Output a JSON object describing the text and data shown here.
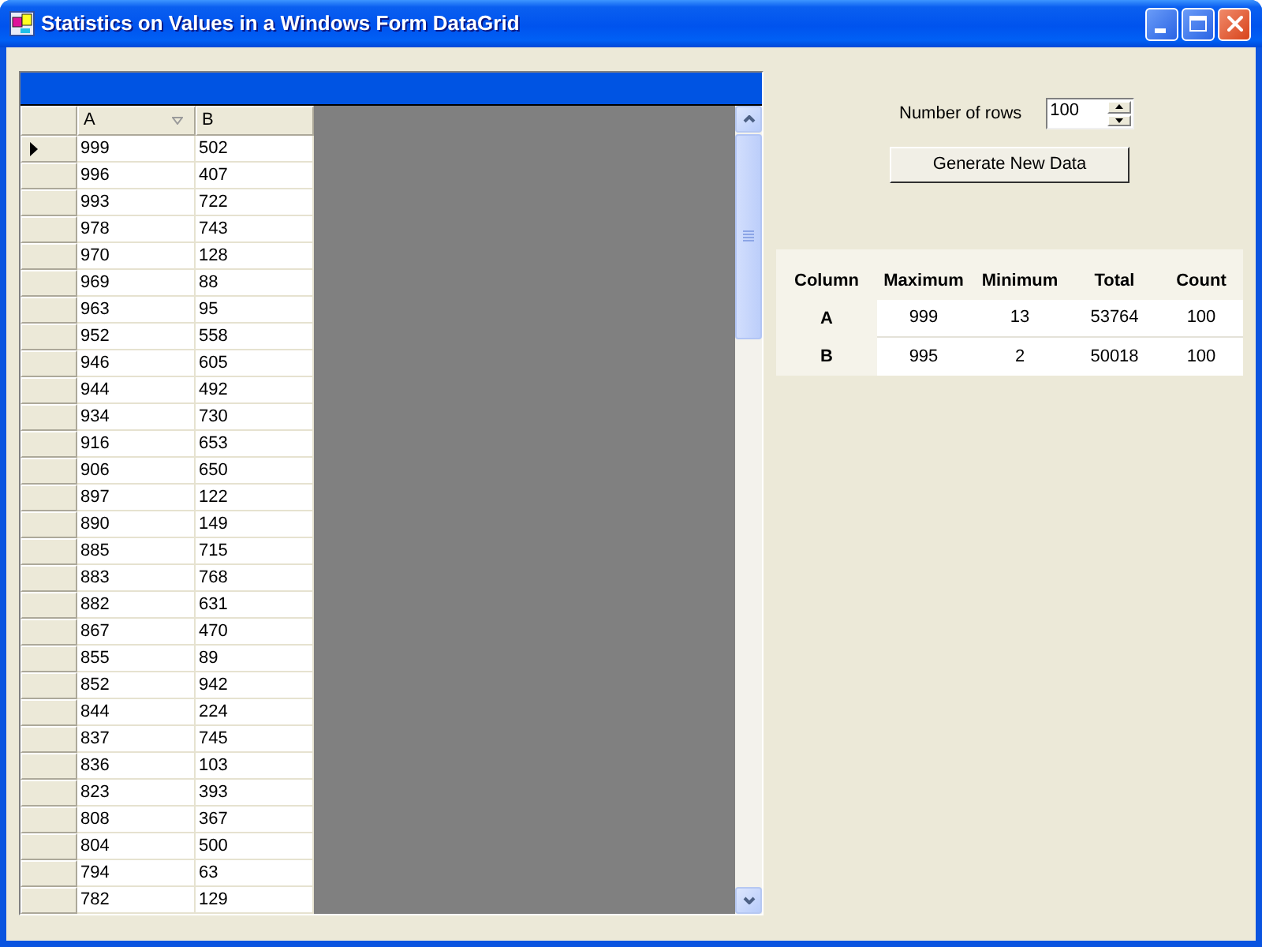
{
  "window": {
    "title": "Statistics on Values in a Windows Form DataGrid"
  },
  "data_grid": {
    "columns": [
      {
        "label": "A",
        "sorted": true
      },
      {
        "label": "B",
        "sorted": false
      }
    ],
    "rows": [
      {
        "selected": true,
        "cells": [
          "999",
          "502"
        ]
      },
      {
        "selected": false,
        "cells": [
          "996",
          "407"
        ]
      },
      {
        "selected": false,
        "cells": [
          "993",
          "722"
        ]
      },
      {
        "selected": false,
        "cells": [
          "978",
          "743"
        ]
      },
      {
        "selected": false,
        "cells": [
          "970",
          "128"
        ]
      },
      {
        "selected": false,
        "cells": [
          "969",
          "88"
        ]
      },
      {
        "selected": false,
        "cells": [
          "963",
          "95"
        ]
      },
      {
        "selected": false,
        "cells": [
          "952",
          "558"
        ]
      },
      {
        "selected": false,
        "cells": [
          "946",
          "605"
        ]
      },
      {
        "selected": false,
        "cells": [
          "944",
          "492"
        ]
      },
      {
        "selected": false,
        "cells": [
          "934",
          "730"
        ]
      },
      {
        "selected": false,
        "cells": [
          "916",
          "653"
        ]
      },
      {
        "selected": false,
        "cells": [
          "906",
          "650"
        ]
      },
      {
        "selected": false,
        "cells": [
          "897",
          "122"
        ]
      },
      {
        "selected": false,
        "cells": [
          "890",
          "149"
        ]
      },
      {
        "selected": false,
        "cells": [
          "885",
          "715"
        ]
      },
      {
        "selected": false,
        "cells": [
          "883",
          "768"
        ]
      },
      {
        "selected": false,
        "cells": [
          "882",
          "631"
        ]
      },
      {
        "selected": false,
        "cells": [
          "867",
          "470"
        ]
      },
      {
        "selected": false,
        "cells": [
          "855",
          "89"
        ]
      },
      {
        "selected": false,
        "cells": [
          "852",
          "942"
        ]
      },
      {
        "selected": false,
        "cells": [
          "844",
          "224"
        ]
      },
      {
        "selected": false,
        "cells": [
          "837",
          "745"
        ]
      },
      {
        "selected": false,
        "cells": [
          "836",
          "103"
        ]
      },
      {
        "selected": false,
        "cells": [
          "823",
          "393"
        ]
      },
      {
        "selected": false,
        "cells": [
          "808",
          "367"
        ]
      },
      {
        "selected": false,
        "cells": [
          "804",
          "500"
        ]
      },
      {
        "selected": false,
        "cells": [
          "794",
          "63"
        ]
      },
      {
        "selected": false,
        "cells": [
          "782",
          "129"
        ]
      }
    ]
  },
  "controls": {
    "rows_label": "Number of rows",
    "rows_value": "100",
    "generate_button": "Generate New Data"
  },
  "statistics": {
    "columns": [
      "Column",
      "Maximum",
      "Minimum",
      "Total",
      "Count"
    ],
    "rows": [
      {
        "label": "A",
        "values": [
          "999",
          "13",
          "53764",
          "100"
        ]
      },
      {
        "label": "B",
        "values": [
          "995",
          "2",
          "50018",
          "100"
        ]
      }
    ]
  }
}
